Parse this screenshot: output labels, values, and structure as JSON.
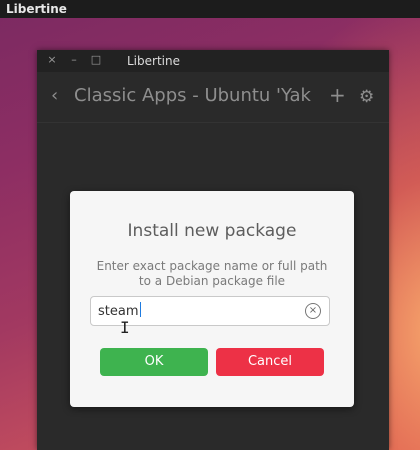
{
  "desktop": {
    "app_name": "Libertine"
  },
  "window": {
    "title": "Libertine",
    "controls": {
      "close": "×",
      "minimize": "–",
      "maximize": "□"
    },
    "header": {
      "back_icon": "‹",
      "title": "Classic Apps - Ubuntu 'Yakk...",
      "add_icon": "+",
      "settings_icon": "⚙"
    }
  },
  "dialog": {
    "title": "Install new package",
    "description": "Enter exact package name or full path to a Debian package file",
    "input": {
      "value": "steam",
      "clear_icon": "×"
    },
    "ok_label": "OK",
    "cancel_label": "Cancel",
    "colors": {
      "ok": "#3eb34f",
      "cancel": "#ed3146"
    }
  }
}
